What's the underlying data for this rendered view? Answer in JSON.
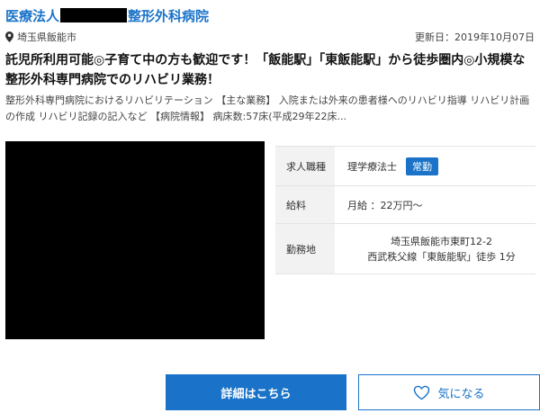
{
  "org": {
    "prefix": "医療法人",
    "suffix": "整形外科病院"
  },
  "location": "埼玉県飯能市",
  "updated": "更新日：2019年10月07日",
  "headline": "託児所利用可能◎子育て中の方も歓迎です！「飯能駅」「東飯能駅」から徒歩圏内◎小規模な整形外科専門病院でのリハビリ業務！",
  "description": "整形外科専門病院におけるリハビリテーション 【主な業務】 入院または外来の患者様へのリハビリ指導 リハビリ計画の作成 リハビリ記録の記入など 【病院情報】 病床数:57床(平成29年22床...",
  "info": {
    "job_type_label": "求人職種",
    "job_type_value": "理学療法士",
    "employment_badge": "常勤",
    "salary_label": "給料",
    "salary_value": "月給 ：22万円〜",
    "workplace_label": "勤務地",
    "workplace_address": "埼玉県飯能市東町12-2",
    "workplace_access": "西武秩父線「東飯能駅」徒歩 1分"
  },
  "buttons": {
    "detail": "詳細はこちら",
    "favorite": "気になる"
  },
  "colors": {
    "accent": "#1a73c8",
    "key_bg": "#f2f2f2"
  }
}
